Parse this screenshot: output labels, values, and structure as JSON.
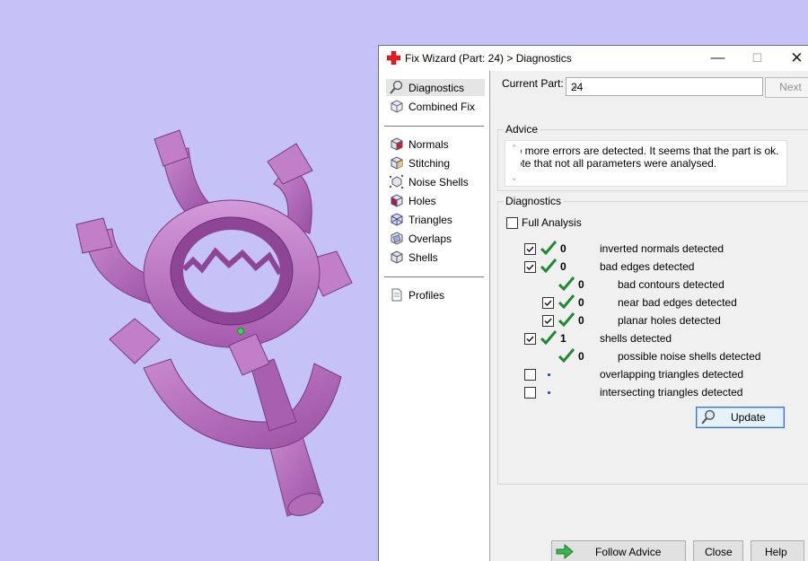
{
  "dialog": {
    "title": "Fix Wizard (Part: 24) > Diagnostics",
    "window_controls": {
      "minimize": "—",
      "maximize": "☐",
      "close": "✕"
    }
  },
  "sidebar": {
    "items": [
      {
        "label": "Diagnostics",
        "icon": "magnifier-icon",
        "selected": true
      },
      {
        "label": "Combined Fix",
        "icon": "cube-icon"
      },
      {
        "label": "Normals",
        "icon": "normals-cube-icon"
      },
      {
        "label": "Stitching",
        "icon": "stitching-cube-icon"
      },
      {
        "label": "Noise Shells",
        "icon": "noise-shells-icon"
      },
      {
        "label": "Holes",
        "icon": "holes-cube-icon"
      },
      {
        "label": "Triangles",
        "icon": "triangles-cube-icon"
      },
      {
        "label": "Overlaps",
        "icon": "overlaps-cube-icon"
      },
      {
        "label": "Shells",
        "icon": "shells-cube-icon"
      },
      {
        "label": "Profiles",
        "icon": "document-icon"
      }
    ]
  },
  "current_part": {
    "label": "Current Part:",
    "value": "24"
  },
  "next_button": "Next",
  "advice": {
    "title": "Advice",
    "line1": "No more errors are detected. It seems that the part is ok.",
    "line2": "Note that not all parameters were analysed."
  },
  "diagnostics": {
    "title": "Diagnostics",
    "full_analysis_label": "Full Analysis",
    "full_analysis_checked": false,
    "rows": [
      {
        "count": "0",
        "label": "inverted normals detected",
        "checked": true,
        "status": "ok"
      },
      {
        "count": "0",
        "label": "bad edges detected",
        "checked": true,
        "status": "ok"
      },
      {
        "count": "0",
        "label": "bad contours detected",
        "status": "ok"
      },
      {
        "count": "0",
        "label": "near bad edges detected",
        "checked": true,
        "status": "ok"
      },
      {
        "count": "0",
        "label": "planar holes detected",
        "checked": true,
        "status": "ok"
      },
      {
        "count": "1",
        "label": "shells detected",
        "checked": true,
        "status": "ok"
      },
      {
        "count": "0",
        "label": "possible noise shells detected",
        "status": "ok"
      },
      {
        "count": "",
        "label": "overlapping triangles detected",
        "checked": false,
        "status": "pending"
      },
      {
        "count": "",
        "label": "intersecting triangles detected",
        "checked": false,
        "status": "pending"
      }
    ],
    "update_button": "Update"
  },
  "footer": {
    "follow_advice": "Follow Advice",
    "close": "Close",
    "help": "Help"
  },
  "colors": {
    "viewport_background": "#c4c2f6",
    "part_color": "#b76bbd",
    "ok_check": "#1e8a2e",
    "pending_dot": "#1a3cc8"
  }
}
